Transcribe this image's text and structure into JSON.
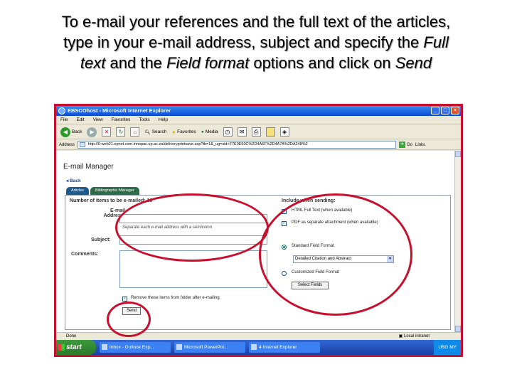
{
  "caption": {
    "line1": "To e-mail your references and the full text of the articles,",
    "line2": "type in your e-mail address, subject and specify the",
    "line2_italic": "Full",
    "line3_italic_a": "text",
    "line3_mid": "and the",
    "line3_italic_b": "Field format",
    "line3_end": "options and click on",
    "line3_italic_c": "Send"
  },
  "window": {
    "title": "EBSCOhost - Microsoft Internet Explorer",
    "menu": [
      "File",
      "Edit",
      "View",
      "Favorites",
      "Tools",
      "Help"
    ],
    "toolbar": {
      "back": "Back",
      "search": "Search",
      "favorites": "Favorites",
      "media": "Media"
    },
    "address_label": "Address",
    "address_value": "http://0-web21.epnet.com.innopac.up.ac.za/deliveryprintsave.asp?tb=1&_ug=sid+F7E0E50C%2D4A6F%2D4A7A%2DA248%2",
    "go_label": "Go",
    "links_label": "Links"
  },
  "page": {
    "title": "E-mail Manager",
    "back_link": "Back",
    "tabs": [
      "Articles",
      "Bibliographic Manager"
    ],
    "items_label": "Number of items to be e-mailed: 10",
    "email_label_1": "E-mail",
    "email_label_2": "Address:",
    "email_hint": "Separate each e-mail address with a semicolon",
    "subject_label": "Subject:",
    "comments_label": "Comments:",
    "remove_label": "Remove these items from folder after e-mailing",
    "send_label": "Send",
    "include_label": "Include when sending:",
    "html_full_text": "HTML Full Text (when available)",
    "pdf_attachment": "PDF as separate attachment (when available)",
    "standard_format": "Standard Field Format",
    "format_selected": "Detailed Citation and Abstract",
    "customized_format": "Customized Field Format",
    "select_fields": "Select Fields"
  },
  "status": {
    "left": "Done",
    "zone": "Local intranet"
  },
  "taskbar": {
    "start": "start",
    "tasks": [
      "Inbox - Outlook Exp...",
      "Microsoft PowerPoi...",
      "4 Internet Explorer"
    ],
    "tray": "UBG MY"
  },
  "colors": {
    "annotation": "#c8102e",
    "xp_blue": "#0a4ad8",
    "tab_active": "#1d5a8e"
  }
}
